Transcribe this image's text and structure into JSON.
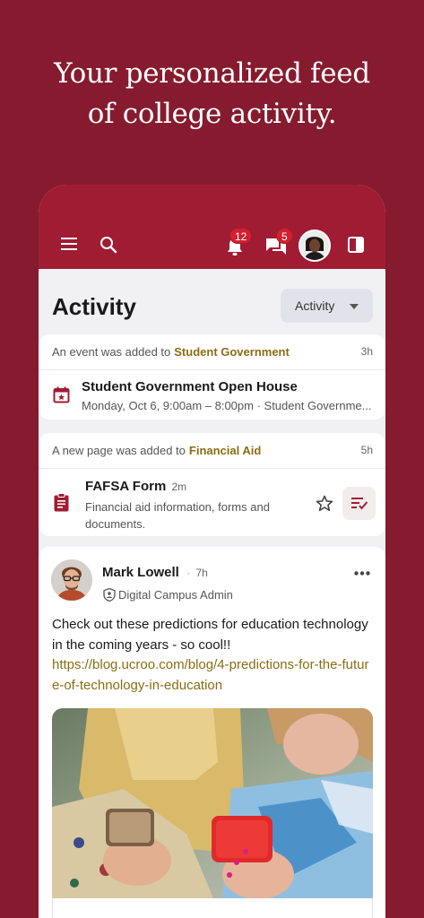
{
  "headline": {
    "line1": "Your personalized feed",
    "line2": "of college activity."
  },
  "topbar": {
    "notifications_count": "12",
    "messages_count": "5"
  },
  "page": {
    "title": "Activity",
    "filter_label": "Activity"
  },
  "feed": [
    {
      "header_prefix": "An event was added to",
      "header_target": "Student Government",
      "age": "3h",
      "title": "Student Government Open House",
      "subtitle": "Monday, Oct 6, 9:00am – 8:00pm · Student Governme..."
    },
    {
      "header_prefix": "A new page was added to",
      "header_target": "Financial Aid",
      "age": "5h",
      "title": "FAFSA Form",
      "title_age": "2m",
      "subtitle_line1": "Financial aid information, forms and",
      "subtitle_line2": "documents."
    }
  ],
  "post": {
    "author": "Mark Lowell",
    "age": "7h",
    "role": "Digital Campus Admin",
    "text": "Check out these predictions for education technology in the coming years - so cool!!",
    "link": "https://blog.ucroo.com/blog/4-predictions-for-the-future-of-technology-in-education"
  },
  "colors": {
    "background": "#861b2f",
    "topbar": "#a01c33",
    "accent_text": "#8a6d12",
    "badge": "#d3202f"
  },
  "icons": {
    "menu": "hamburger-icon",
    "search": "search-icon",
    "notifications": "bell-icon",
    "messages": "chat-icon",
    "panel": "panel-toggle-icon",
    "event": "calendar-star-icon",
    "page": "clipboard-icon",
    "star": "star-outline-icon",
    "list": "list-check-icon",
    "more": "more-horizontal-icon",
    "admin": "shield-user-icon"
  }
}
